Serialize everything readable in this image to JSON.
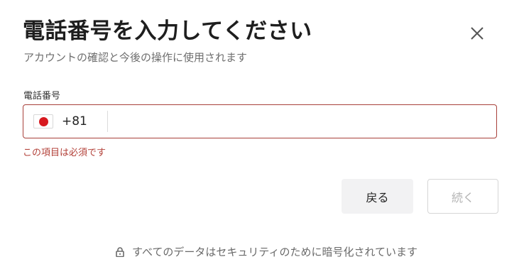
{
  "dialog": {
    "title": "電話番号を入力してください",
    "subtitle": "アカウントの確認と今後の操作に使用されます",
    "close_icon": "close-icon"
  },
  "phone": {
    "label": "電話番号",
    "country_flag": "japan-flag-icon",
    "dial_code": "+81",
    "value": "",
    "placeholder": "",
    "error": "この項目は必須です",
    "error_color": "#b3423a",
    "border_color": "#a8403a"
  },
  "actions": {
    "back_label": "戻る",
    "continue_label": "続く"
  },
  "footer": {
    "lock_icon": "lock-icon",
    "security_text": "すべてのデータはセキュリティのために暗号化されています"
  }
}
